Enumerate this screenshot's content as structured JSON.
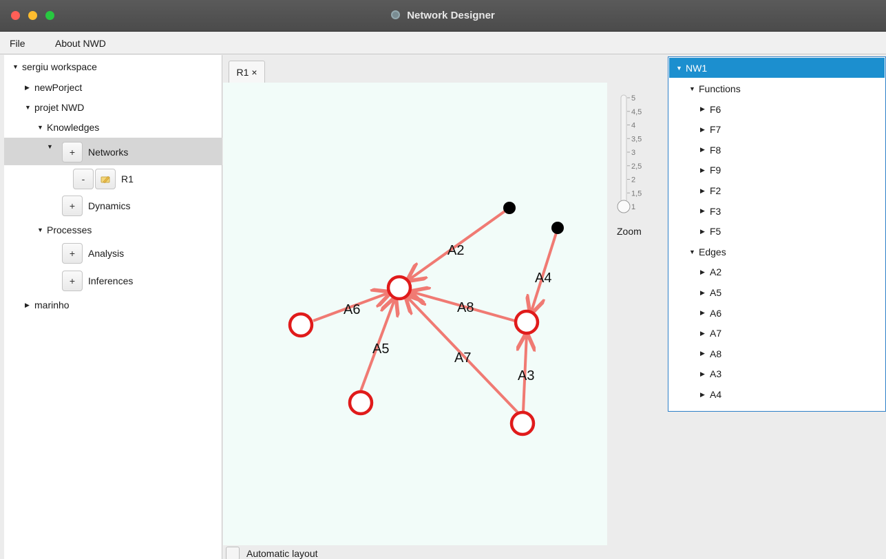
{
  "window": {
    "title": "Network Designer"
  },
  "menu": {
    "file": "File",
    "about": "About NWD"
  },
  "workspace_tree": {
    "root": "sergiu workspace",
    "projects": [
      "newPorject",
      "projet NWD",
      "marinho"
    ],
    "knowledges": "Knowledges",
    "networks_btn": "+",
    "networks": "Networks",
    "r1_minus": "-",
    "r1": "R1",
    "dynamics_btn": "+",
    "dynamics": "Dynamics",
    "processes": "Processes",
    "analysis_btn": "+",
    "analysis": "Analysis",
    "inferences_btn": "+",
    "inferences": "Inferences"
  },
  "editor": {
    "tab_label": "R1",
    "tab_close": "×",
    "auto_layout_label": "Automatic layout",
    "zoom_label": "Zoom",
    "zoom_ticks": [
      "5",
      "4,5",
      "4",
      "3,5",
      "3",
      "2,5",
      "2",
      "1,5",
      "1"
    ],
    "zoom_value": 1
  },
  "graph": {
    "node_color": "#e01b1b",
    "edge_color": "#f07a73",
    "edge_labels": [
      "A2",
      "A4",
      "A6",
      "A8",
      "A5",
      "A7",
      "A3"
    ]
  },
  "network_tree": {
    "root": "NW1",
    "functions_label": "Functions",
    "functions": [
      "F6",
      "F7",
      "F8",
      "F9",
      "F2",
      "F3",
      "F5"
    ],
    "edges_label": "Edges",
    "edges": [
      "A2",
      "A5",
      "A6",
      "A7",
      "A8",
      "A3",
      "A4"
    ],
    "selection_color": "#1c8fcf"
  }
}
